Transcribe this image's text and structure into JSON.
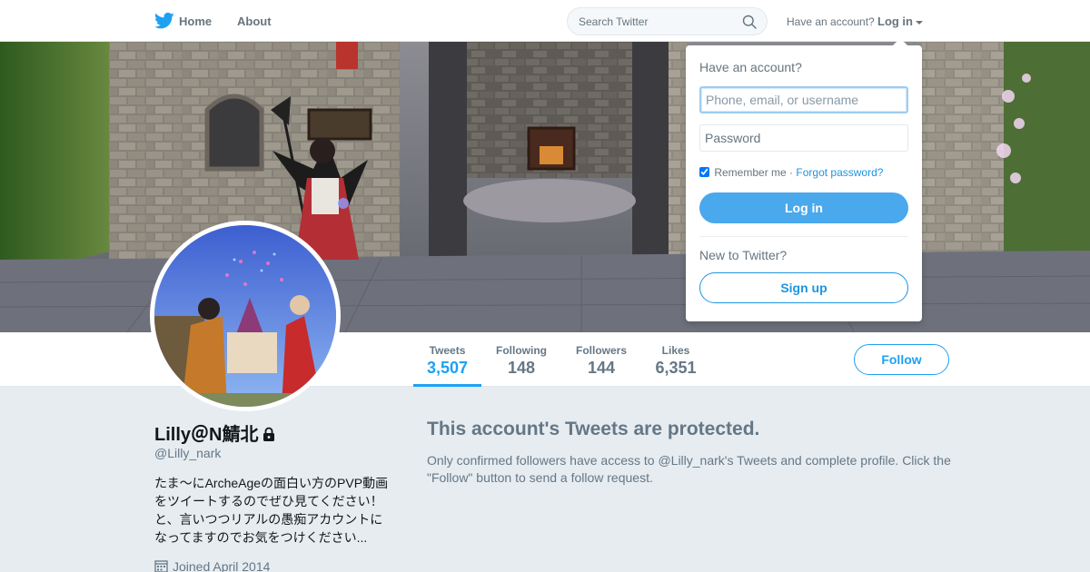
{
  "nav": {
    "home_label": "Home",
    "about_label": "About",
    "search_placeholder": "Search Twitter",
    "have_account": "Have an account?",
    "login_label": "Log in"
  },
  "login_dropdown": {
    "title": "Have an account?",
    "username_placeholder": "Phone, email, or username",
    "password_placeholder": "Password",
    "remember_label": "Remember me",
    "separator": "·",
    "forgot_label": "Forgot password?",
    "remember_checked": true,
    "login_button": "Log in",
    "new_to_twitter": "New to Twitter?",
    "signup_button": "Sign up"
  },
  "profile": {
    "name": "Lilly＠N鯖北",
    "handle": "@Lilly_nark",
    "bio": "たま〜にArcheAgeの面白い方のPVP動画をツイートするのでぜひ見てください！と、言いつつリアルの愚痴アカウントになってますのでお気をつけください...",
    "joined": "Joined April 2014",
    "protected": true
  },
  "stats": {
    "tweets_label": "Tweets",
    "tweets_value": "3,507",
    "following_label": "Following",
    "following_value": "148",
    "followers_label": "Followers",
    "followers_value": "144",
    "likes_label": "Likes",
    "likes_value": "6,351",
    "active_tab": "Tweets"
  },
  "follow_button": "Follow",
  "protected_notice": {
    "title": "This account's Tweets are protected.",
    "body": "Only confirmed followers have access to @Lilly_nark's Tweets and complete profile. Click the \"Follow\" button to send a follow request."
  },
  "colors": {
    "brand_blue": "#1da1f2",
    "link_blue": "#1b95e0",
    "background": "#e6ecf0",
    "muted_text": "#657786"
  },
  "icons": {
    "logo": "twitter-bird-icon",
    "search": "magnifier-icon",
    "lock": "lock-icon",
    "calendar": "calendar-icon",
    "dropdown": "caret-down-icon"
  }
}
